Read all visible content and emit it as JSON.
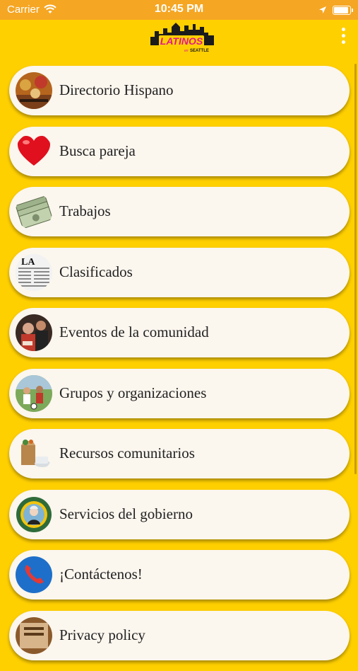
{
  "status_bar": {
    "carrier": "Carrier",
    "time": "10:45 PM"
  },
  "header": {
    "logo_text": "LATINOS",
    "logo_sub": "SEATTLE",
    "logo_in": "en"
  },
  "menu": [
    {
      "label": "Directorio Hispano",
      "icon": "directory-photo-icon"
    },
    {
      "label": "Busca pareja",
      "icon": "heart-icon"
    },
    {
      "label": "Trabajos",
      "icon": "money-icon"
    },
    {
      "label": "Clasificados",
      "icon": "newspaper-icon"
    },
    {
      "label": "Eventos de la comunidad",
      "icon": "community-events-photo-icon"
    },
    {
      "label": "Grupos y organizaciones",
      "icon": "groups-photo-icon"
    },
    {
      "label": "Recursos comunitarios",
      "icon": "groceries-icon"
    },
    {
      "label": "Servicios del gobierno",
      "icon": "state-seal-icon"
    },
    {
      "label": "¡Contáctenos!",
      "icon": "phone-icon"
    },
    {
      "label": "Privacy policy",
      "icon": "privacy-photo-icon"
    }
  ]
}
